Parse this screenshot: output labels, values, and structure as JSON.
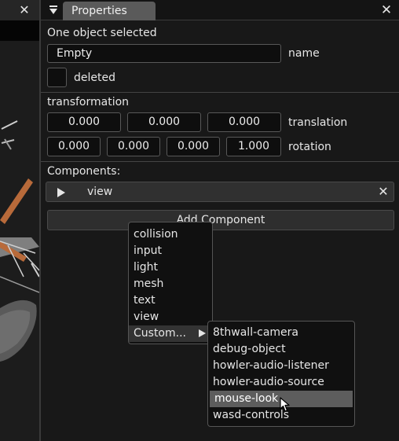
{
  "viewport": {
    "close_glyph": "✕"
  },
  "properties": {
    "tab_title": "Properties",
    "close_glyph": "✕",
    "selection_status": "One object selected",
    "name": {
      "value": "Empty",
      "label": "name"
    },
    "deleted": {
      "label": "deleted",
      "checked": false
    },
    "transformation": {
      "heading": "transformation",
      "translation": {
        "values": [
          "0.000",
          "0.000",
          "0.000"
        ],
        "label": "translation"
      },
      "rotation": {
        "values": [
          "0.000",
          "0.000",
          "0.000",
          "1.000"
        ],
        "label": "rotation"
      }
    },
    "components": {
      "heading": "Components:",
      "items": [
        {
          "name": "view",
          "close_glyph": "✕"
        }
      ]
    },
    "add_component_label": "Add Component"
  },
  "component_menu": {
    "items": [
      "collision",
      "input",
      "light",
      "mesh",
      "text",
      "view"
    ],
    "custom_label": "Custom..."
  },
  "custom_submenu": {
    "items": [
      "8thwall-camera",
      "debug-object",
      "howler-audio-listener",
      "howler-audio-source",
      "mouse-look",
      "wasd-controls"
    ],
    "selected": "mouse-look"
  },
  "colors": {
    "background": "#181818",
    "tab": "#5a5a5a",
    "field_bg": "#0e0e0e",
    "menu_bg": "#101010",
    "menu_selected": "#5d5d5d",
    "scene_orange": "#b86a3a",
    "scene_gray": "#8a8a8a"
  }
}
